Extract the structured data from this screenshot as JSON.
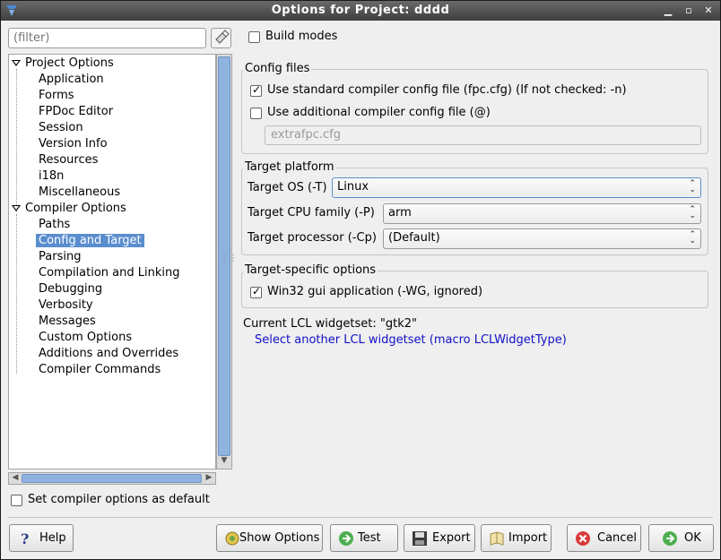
{
  "window": {
    "title": "Options for Project: dddd"
  },
  "filter": {
    "placeholder": "(filter)"
  },
  "tree": {
    "groups": [
      {
        "label": "Project Options",
        "children": [
          "Application",
          "Forms",
          "FPDoc Editor",
          "Session",
          "Version Info",
          "Resources",
          "i18n",
          "Miscellaneous"
        ]
      },
      {
        "label": "Compiler Options",
        "children": [
          "Paths",
          "Config and Target",
          "Parsing",
          "Compilation and Linking",
          "Debugging",
          "Verbosity",
          "Messages",
          "Custom Options",
          "Additions and Overrides",
          "Compiler Commands"
        ]
      }
    ],
    "selected": "Config and Target"
  },
  "set_default": {
    "label": "Set compiler options as default",
    "checked": false
  },
  "build_modes": {
    "label": "Build modes",
    "checked": false
  },
  "config_files": {
    "title": "Config files",
    "use_standard": {
      "label": "Use standard compiler config file (fpc.cfg) (If not checked: -n)",
      "checked": true
    },
    "use_additional": {
      "label": "Use additional compiler config file (@)",
      "checked": false
    },
    "additional_value": "extrafpc.cfg"
  },
  "target_platform": {
    "title": "Target platform",
    "os_label": "Target OS (-T)",
    "os_value": "Linux",
    "cpu_label": "Target CPU family (-P)",
    "cpu_value": "arm",
    "proc_label": "Target processor (-Cp)",
    "proc_value": "(Default)"
  },
  "target_specific": {
    "title": "Target-specific options",
    "win32": {
      "label": "Win32 gui application (-WG, ignored)",
      "checked": true
    }
  },
  "widgetset": {
    "current": "Current LCL widgetset: \"gtk2\"",
    "link": "Select another LCL widgetset (macro LCLWidgetType)"
  },
  "buttons": {
    "help": "Help",
    "show_options": "Show Options",
    "test": "Test",
    "export": "Export",
    "import": "Import",
    "cancel": "Cancel",
    "ok": "OK"
  },
  "colors": {
    "selection": "#5a8dce",
    "link": "#1010c8",
    "titlebar": "#4a4a4a"
  }
}
